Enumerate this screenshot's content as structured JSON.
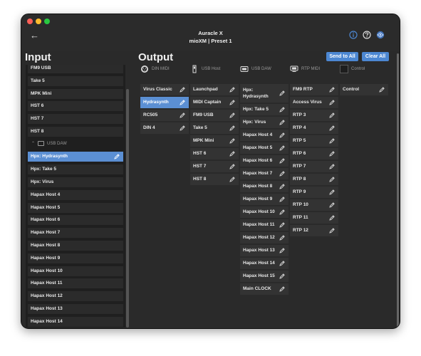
{
  "window": {
    "title": "Auracle X",
    "subtitle": "mioXM | Preset 1"
  },
  "colors": {
    "accent": "#4c87d2",
    "selected": "#5b8fd3",
    "bg": "#2a2a2a"
  },
  "icons": [
    "back-arrow-icon",
    "info-icon",
    "help-icon",
    "network-icon",
    "pencil-icon",
    "usb-daw-icon",
    "din-midi-icon",
    "usb-host-icon",
    "rtp-midi-icon"
  ],
  "input": {
    "heading": "Input",
    "items_top": [
      "FM9 USB",
      "Take 5",
      "MPK Mini",
      "HST 6",
      "HST 7",
      "HST 8"
    ],
    "group_label": "USB DAW",
    "items_bottom": [
      "Hpx: Hydrasynth",
      "Hpx: Take 5",
      "Hpx: Virus",
      "Hapax Host 4",
      "Hapax Host 5",
      "Hapax Host 6",
      "Hapax Host 7",
      "Hapax Host 8",
      "Hapax Host 9",
      "Hapax Host 10",
      "Hapax Host 11",
      "Hapax Host 12",
      "Hapax Host 13",
      "Hapax Host 14"
    ]
  },
  "output": {
    "heading": "Output",
    "send_all": "Send to All",
    "clear_all": "Clear All",
    "columns": [
      {
        "label": "DIN MIDI",
        "items": [
          "Virus Classic",
          "Hydrasynth",
          "RC505",
          "DIN 4"
        ]
      },
      {
        "label": "USB Host",
        "items": [
          "Launchpad",
          "MIDI Captain",
          "FM9 USB",
          "Take 5",
          "MPK Mini",
          "HST 6",
          "HST 7",
          "HST 8"
        ]
      },
      {
        "label": "USB DAW",
        "items": [
          "Hpx: Hydrasynth",
          "Hpx: Take 5",
          "Hpx: Virus",
          "Hapax Host 4",
          "Hapax Host 5",
          "Hapax Host 6",
          "Hapax Host 7",
          "Hapax Host 8",
          "Hapax Host 9",
          "Hapax Host 10",
          "Hapax Host 11",
          "Hapax Host 12",
          "Hapax Host 13",
          "Hapax Host 14",
          "Hapax Host 15",
          "Main CLOCK"
        ]
      },
      {
        "label": "RTP MIDI",
        "items": [
          "FM9 RTP",
          "Access Virus",
          "RTP 3",
          "RTP 4",
          "RTP 5",
          "RTP 6",
          "RTP 7",
          "RTP 8",
          "RTP 9",
          "RTP 10",
          "RTP 11",
          "RTP 12"
        ]
      },
      {
        "label": "Control",
        "items": [
          "Control"
        ]
      }
    ]
  }
}
